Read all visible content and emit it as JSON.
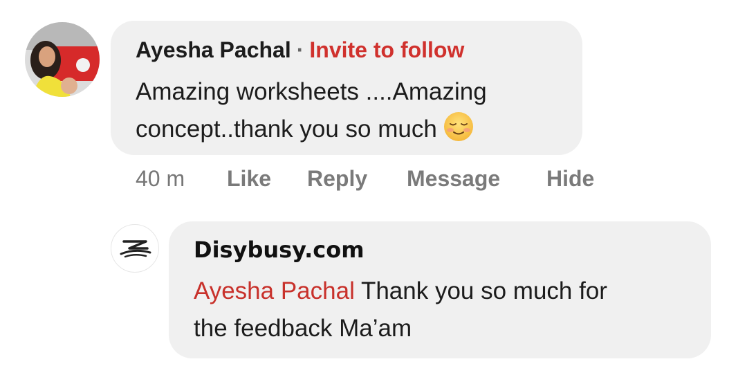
{
  "comment": {
    "author": "Ayesha Pachal",
    "separator": "·",
    "invite_label": "Invite to follow",
    "text_line1": "Amazing worksheets ....Amazing",
    "text_line2": "concept..thank you so much",
    "emoji": "smiling-blush-emoji"
  },
  "actions": {
    "time": "40 m",
    "like": "Like",
    "reply": "Reply",
    "message": "Message",
    "hide": "Hide"
  },
  "reply": {
    "author": "Disybusy.com",
    "mention": "Ayesha Pachal",
    "text_line1_rest": " Thank you so much for",
    "text_line2": "the feedback Ma’am"
  },
  "colors": {
    "bubble": "#f0f0f0",
    "invite": "#d0312d",
    "mention": "#c8312b",
    "action_text": "#7a7a7a"
  }
}
